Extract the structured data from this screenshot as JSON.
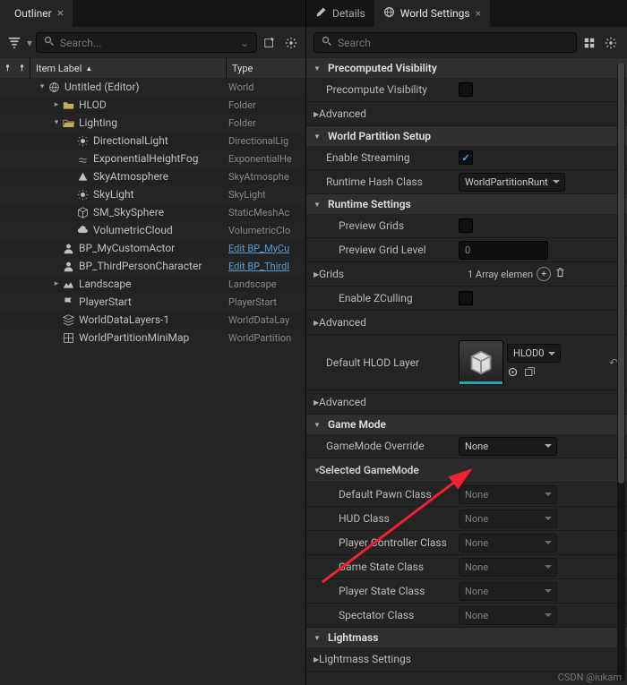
{
  "tabs": {
    "outliner": "Outliner",
    "details": "Details",
    "world_settings": "World Settings"
  },
  "search": {
    "placeholder_outliner": "Search...",
    "placeholder_right": "Search"
  },
  "outliner_header": {
    "label": "Item Label",
    "type": "Type"
  },
  "tree": [
    {
      "depth": 0,
      "arrow": "▾",
      "icon": "world",
      "label": "Untitled (Editor)",
      "type": "World"
    },
    {
      "depth": 1,
      "arrow": "▸",
      "icon": "folder",
      "label": "HLOD",
      "type": "Folder"
    },
    {
      "depth": 1,
      "arrow": "▾",
      "icon": "folder-o",
      "label": "Lighting",
      "type": "Folder"
    },
    {
      "depth": 2,
      "arrow": "",
      "icon": "light",
      "label": "DirectionalLight",
      "type": "DirectionalLig"
    },
    {
      "depth": 2,
      "arrow": "",
      "icon": "fx",
      "label": "ExponentialHeightFog",
      "type": "ExponentialHe"
    },
    {
      "depth": 2,
      "arrow": "",
      "icon": "sky",
      "label": "SkyAtmosphere",
      "type": "SkyAtmosphe"
    },
    {
      "depth": 2,
      "arrow": "",
      "icon": "light",
      "label": "SkyLight",
      "type": "SkyLight"
    },
    {
      "depth": 2,
      "arrow": "",
      "icon": "mesh",
      "label": "SM_SkySphere",
      "type": "StaticMeshAc"
    },
    {
      "depth": 2,
      "arrow": "",
      "icon": "cloud",
      "label": "VolumetricCloud",
      "type": "VolumetricClo"
    },
    {
      "depth": 1,
      "arrow": "",
      "icon": "actor",
      "label": "BP_MyCustomActor",
      "type": "Edit BP_MyCu",
      "link": true
    },
    {
      "depth": 1,
      "arrow": "",
      "icon": "actor",
      "label": "BP_ThirdPersonCharacter",
      "type": "Edit BP_ThirdI",
      "link": true
    },
    {
      "depth": 1,
      "arrow": "▸",
      "icon": "land",
      "label": "Landscape",
      "type": "Landscape"
    },
    {
      "depth": 1,
      "arrow": "",
      "icon": "flag",
      "label": "PlayerStart",
      "type": "PlayerStart"
    },
    {
      "depth": 1,
      "arrow": "",
      "icon": "layers",
      "label": "WorldDataLayers-1",
      "type": "WorldDataLay"
    },
    {
      "depth": 1,
      "arrow": "",
      "icon": "map",
      "label": "WorldPartitionMiniMap",
      "type": "WorldPartition"
    }
  ],
  "cats": {
    "precomputed_visibility": "Precomputed Visibility",
    "world_partition_setup": "World Partition Setup",
    "runtime_settings": "Runtime Settings",
    "game_mode": "Game Mode",
    "selected_gamemode": "Selected GameMode",
    "lightmass": "Lightmass",
    "advanced": "Advanced"
  },
  "props": {
    "precompute_visibility": "Precompute Visibility",
    "enable_streaming": "Enable Streaming",
    "runtime_hash_class": "Runtime Hash Class",
    "runtime_hash_value": "WorldPartitionRunt",
    "preview_grids": "Preview Grids",
    "preview_grid_level": "Preview Grid Level",
    "preview_grid_level_value": "0",
    "grids": "Grids",
    "grids_value": "1 Array elemen",
    "enable_zculling": "Enable ZCulling",
    "default_hlod_layer": "Default HLOD Layer",
    "hlod_value": "HLOD0",
    "gamemode_override": "GameMode Override",
    "none": "None",
    "default_pawn_class": "Default Pawn Class",
    "hud_class": "HUD Class",
    "player_controller_class": "Player Controller Class",
    "game_state_class": "Game State Class",
    "player_state_class": "Player State Class",
    "spectator_class": "Spectator Class",
    "lightmass_settings": "Lightmass Settings"
  },
  "watermark": "CSDN @iukam"
}
